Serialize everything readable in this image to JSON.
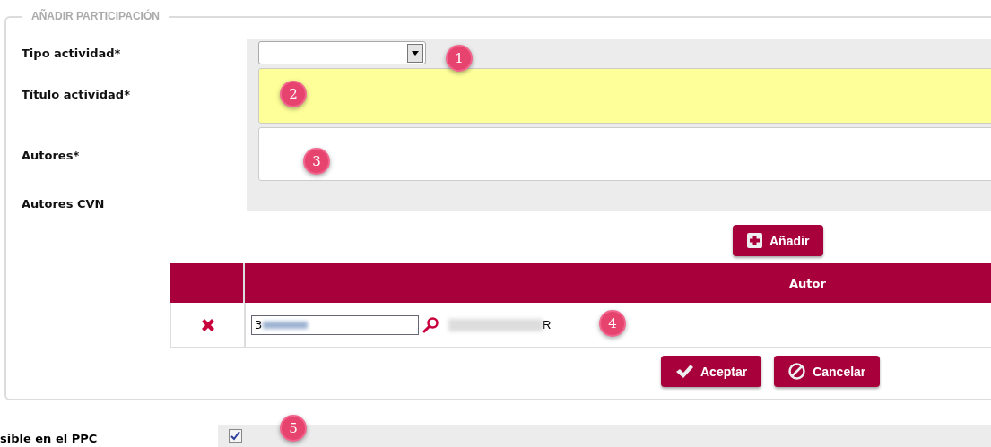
{
  "section": {
    "legend": "AÑADIR PARTICIPACIÓN"
  },
  "fields": [
    {
      "kind": "select",
      "label": "Tipo actividad*"
    },
    {
      "kind": "textarea",
      "label": "Título actividad*",
      "highlighted": true
    },
    {
      "kind": "textarea",
      "label": "Autores*",
      "highlighted": false
    },
    {
      "kind": "label",
      "label": "Autores CVN"
    }
  ],
  "add_button": {
    "label": "Añadir"
  },
  "table": {
    "columns": [
      "Autor"
    ],
    "rows": [
      {
        "code": "3",
        "name": "R"
      }
    ]
  },
  "buttons": [
    {
      "kind": "accept",
      "label": "Aceptar"
    },
    {
      "kind": "cancel",
      "label": "Cancelar"
    }
  ],
  "visible_field": {
    "label": "sible en el PPC",
    "checked": true
  },
  "annotations": [
    "1",
    "2",
    "3",
    "4",
    "5"
  ]
}
